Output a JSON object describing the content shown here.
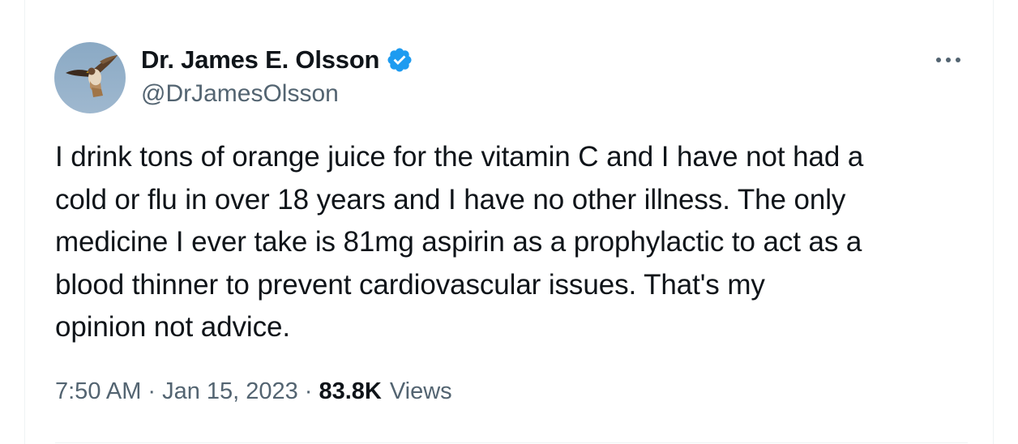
{
  "tweet": {
    "author": {
      "display_name": "Dr. James E. Olsson",
      "handle": "@DrJamesOlsson",
      "verified": true
    },
    "text": "I drink tons of orange juice for the vitamin C and I have not had a\ncold or flu in over 18 years and I have no other illness. The only\nmedicine I ever take is 81mg aspirin as a prophylactic to act as a\nblood thinner to prevent cardiovascular issues. That's my\nopinion not advice.",
    "time": "7:50 AM",
    "date": "Jan 15, 2023",
    "separator": "·",
    "views_count": "83.8K",
    "views_label": "Views"
  },
  "icons": {
    "verified": "verified-badge-icon",
    "more": "more-horizontal-icon",
    "avatar": "hawk-avatar"
  },
  "colors": {
    "text_primary": "#0f1419",
    "text_secondary": "#536471",
    "verified_blue": "#1d9bf0",
    "divider": "#eff3f4"
  }
}
